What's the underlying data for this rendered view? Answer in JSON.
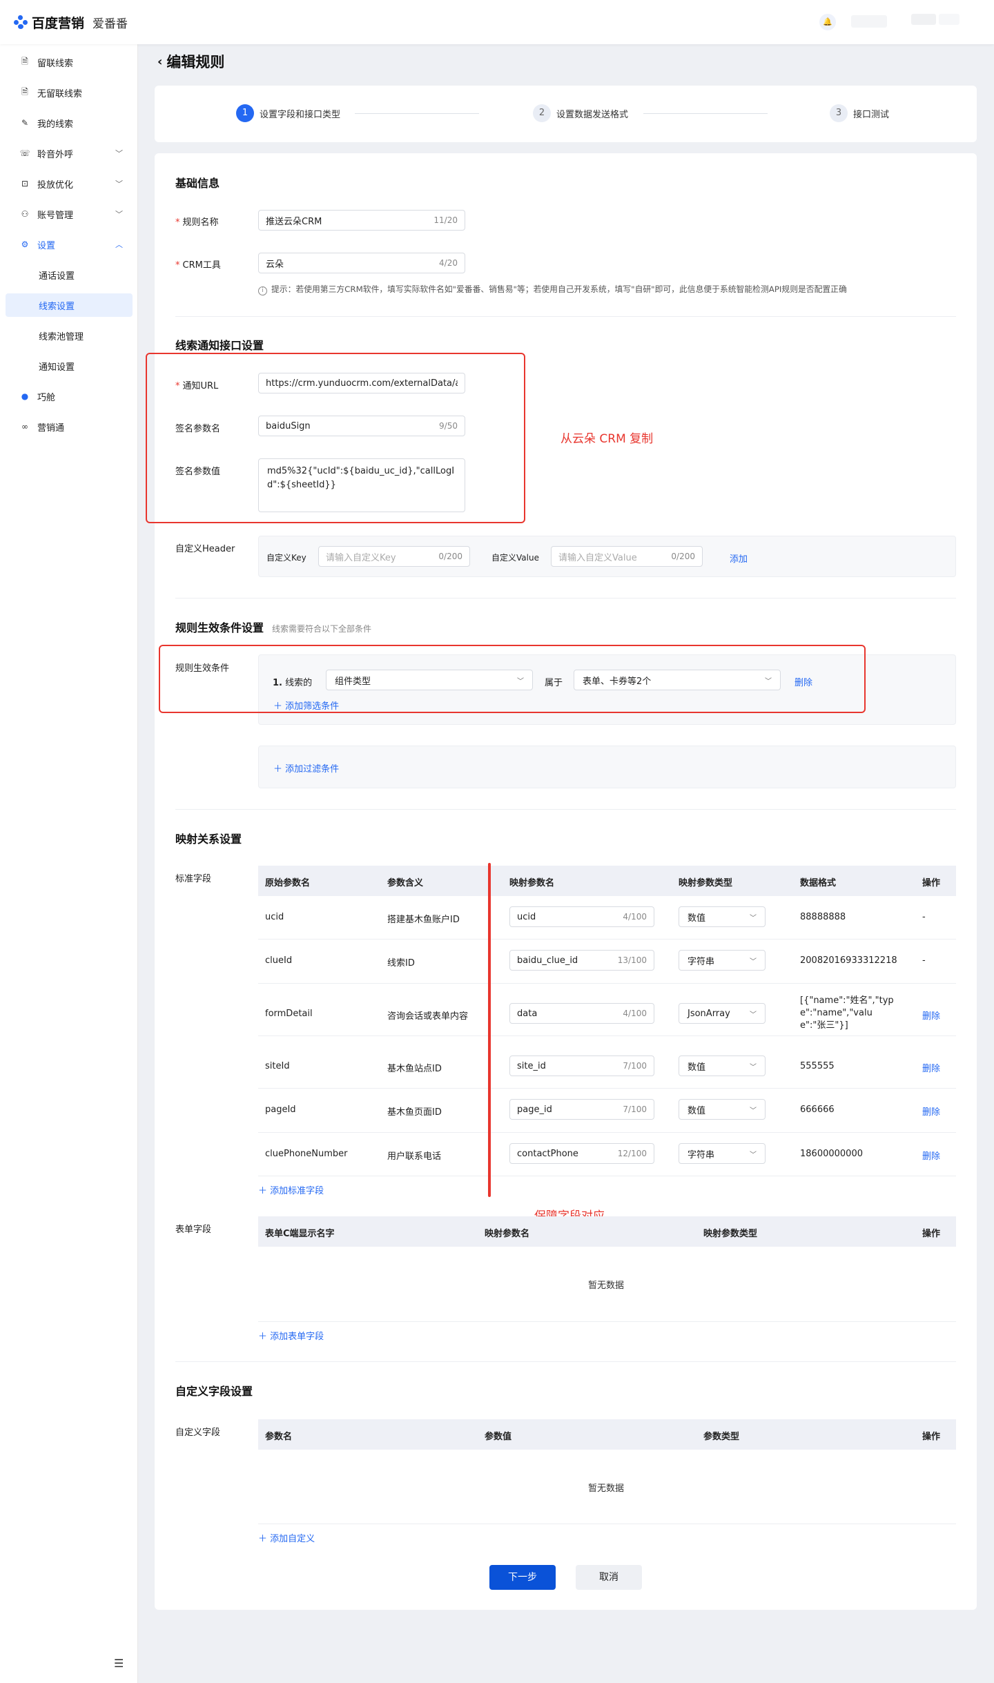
{
  "brand": {
    "name": "百度营销",
    "product": "爱番番"
  },
  "sidebar": {
    "items": [
      {
        "label": "留联线索",
        "icon": "doc-icon"
      },
      {
        "label": "无留联线索",
        "icon": "doc-icon"
      },
      {
        "label": "我的线索",
        "icon": "edit-doc-icon"
      },
      {
        "label": "聆音外呼",
        "icon": "phone-icon"
      },
      {
        "label": "投放优化",
        "icon": "bag-icon"
      },
      {
        "label": "账号管理",
        "icon": "user-icon"
      },
      {
        "label": "设置",
        "icon": "gear-icon"
      },
      {
        "label": "巧舱",
        "icon": "planet-icon"
      },
      {
        "label": "营销通",
        "icon": "link-icon"
      }
    ],
    "sub": [
      "通话设置",
      "线索设置",
      "线索池管理",
      "通知设置"
    ]
  },
  "page": {
    "title": "编辑规则"
  },
  "steps": [
    {
      "num": "1",
      "label": "设置字段和接口类型"
    },
    {
      "num": "2",
      "label": "设置数据发送格式"
    },
    {
      "num": "3",
      "label": "接口测试"
    }
  ],
  "basic": {
    "title": "基础信息",
    "rule_name_label": "规则名称",
    "rule_name_value": "推送云朵CRM",
    "rule_name_count": "11/20",
    "crm_label": "CRM工具",
    "crm_value": "云朵",
    "crm_count": "4/20",
    "hint": "提示：若使用第三方CRM软件，填写实际软件名如\"爱番番、销售易\"等；若使用自己开发系统，填写\"自研\"即可，此信息便于系统智能检测API规则是否配置正确"
  },
  "notify": {
    "title": "线索通知接口设置",
    "url_label": "通知URL",
    "url_value": "https://crm.yunduocrm.com/externalData/a",
    "sign_name_label": "签名参数名",
    "sign_name_value": "baiduSign",
    "sign_name_count": "9/50",
    "sign_value_label": "签名参数值",
    "sign_value_value": "md5%32{\"ucId\":${baidu_uc_id},\"callLogId\":${sheetId}}",
    "header_label": "自定义Header",
    "key_label": "自定义Key",
    "key_placeholder": "请输入自定义Key",
    "key_count": "0/200",
    "value_label": "自定义Value",
    "value_placeholder": "请输入自定义Value",
    "value_count": "0/200",
    "add_label": "添加",
    "annotation": "从云朵 CRM 复制"
  },
  "conditions": {
    "title": "规则生效条件设置",
    "hint": "线索需要符合以下全部条件",
    "label": "规则生效条件",
    "row_num": "1.",
    "row_prefix": "线索的",
    "field_value": "组件类型",
    "op_label": "属于",
    "target_value": "表单、卡券等2个",
    "delete_label": "删除",
    "add_filter": "添加筛选条件",
    "add_condition": "添加过滤条件"
  },
  "mapping": {
    "title": "映射关系设置",
    "std_label": "标准字段",
    "headers": [
      "原始参数名",
      "参数含义",
      "映射参数名",
      "映射参数类型",
      "数据格式",
      "操作"
    ],
    "rows": [
      {
        "orig": "ucid",
        "meaning": "搭建基木鱼账户ID",
        "map": "ucid",
        "count": "4/100",
        "type": "数值",
        "format": "88888888",
        "op": "-"
      },
      {
        "orig": "clueId",
        "meaning": "线索ID",
        "map": "baidu_clue_id",
        "count": "13/100",
        "type": "字符串",
        "format": "20082016933312218",
        "op": "-"
      },
      {
        "orig": "formDetail",
        "meaning": "咨询会话或表单内容",
        "map": "data",
        "count": "4/100",
        "type": "JsonArray",
        "format": "[{\"name\":\"姓名\",\"type\":\"name\",\"value\":\"张三\"}]",
        "op": "删除"
      },
      {
        "orig": "siteId",
        "meaning": "基木鱼站点ID",
        "map": "site_id",
        "count": "7/100",
        "type": "数值",
        "format": "555555",
        "op": "删除"
      },
      {
        "orig": "pageId",
        "meaning": "基木鱼页面ID",
        "map": "page_id",
        "count": "7/100",
        "type": "数值",
        "format": "666666",
        "op": "删除"
      },
      {
        "orig": "cluePhoneNumber",
        "meaning": "用户联系电话",
        "map": "contactPhone",
        "count": "12/100",
        "type": "字符串",
        "format": "18600000000",
        "op": "删除"
      }
    ],
    "add_std": "添加标准字段",
    "annotation": "保障字段对应",
    "form_label": "表单字段",
    "form_headers": [
      "表单C端显示名字",
      "映射参数名",
      "映射参数类型",
      "操作"
    ],
    "form_empty": "暂无数据",
    "add_form": "添加表单字段"
  },
  "custom": {
    "title": "自定义字段设置",
    "label": "自定义字段",
    "headers": [
      "参数名",
      "参数值",
      "参数类型",
      "操作"
    ],
    "empty": "暂无数据",
    "add": "添加自定义"
  },
  "footer": {
    "next": "下一步",
    "cancel": "取消"
  }
}
